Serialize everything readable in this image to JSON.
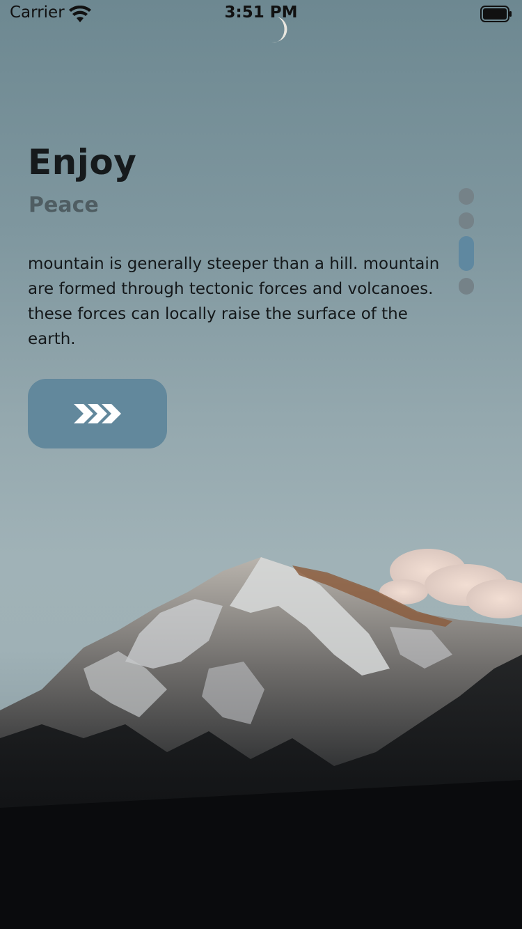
{
  "status_bar": {
    "carrier": "Carrier",
    "time": "3:51 PM"
  },
  "main": {
    "title": "Enjoy",
    "subtitle": "Peace",
    "description": "mountain is generally steeper than a hill. mountain are formed through tectonic forces and volcanoes. these forces can locally raise the surface of the earth.",
    "next_button_icon": "triple-chevron-right-icon"
  },
  "page_indicator": {
    "count": 4,
    "active_index": 2
  },
  "colors": {
    "accent": "#62889c",
    "dot_inactive": "#758288"
  }
}
